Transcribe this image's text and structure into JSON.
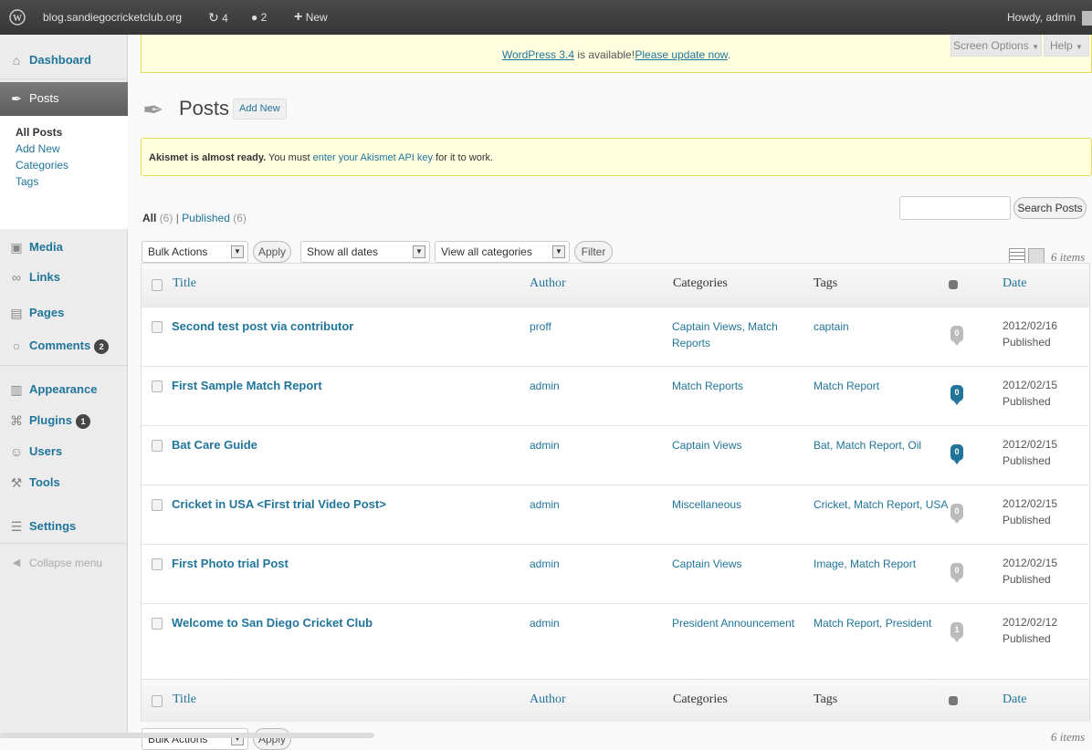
{
  "adminbar": {
    "site": "blog.sandiegocricketclub.org",
    "updates": "4",
    "comments": "2",
    "new": "New",
    "howdy": "Howdy, admin"
  },
  "menu": {
    "dashboard": "Dashboard",
    "posts": "Posts",
    "posts_sub": [
      "All Posts",
      "Add New",
      "Categories",
      "Tags"
    ],
    "media": "Media",
    "links": "Links",
    "pages": "Pages",
    "comments": "Comments",
    "comments_count": "2",
    "appearance": "Appearance",
    "plugins": "Plugins",
    "plugins_count": "1",
    "users": "Users",
    "tools": "Tools",
    "settings": "Settings",
    "collapse": "Collapse menu"
  },
  "notice": {
    "version_link": "WordPress 3.4",
    "middle": "is available!",
    "update_link": "Please update now",
    "period": "."
  },
  "screen_options": "Screen Options",
  "help": "Help",
  "page": {
    "title": "Posts",
    "add_new": "Add New"
  },
  "akismet": {
    "bold": "Akismet is almost ready.",
    "pre": "You must",
    "link": "enter your Akismet API key",
    "post": "for it to work."
  },
  "filters": {
    "all": "All",
    "all_count": "(6)",
    "sep": "|",
    "published": "Published",
    "published_count": "(6)",
    "bulk_actions": "Bulk Actions",
    "apply": "Apply",
    "dates": "Show all dates",
    "categories": "View all categories",
    "filter": "Filter",
    "items": "6 items",
    "search_button": "Search Posts",
    "search_value": ""
  },
  "table": {
    "headers": {
      "title": "Title",
      "author": "Author",
      "categories": "Categories",
      "tags": "Tags",
      "date": "Date"
    },
    "rows": [
      {
        "title": "Second test post via contributor",
        "author": "proff",
        "categories": "Captain Views, Match Reports",
        "tags": "captain",
        "comments": "0",
        "date": "2012/02/16",
        "status": "Published",
        "active": false
      },
      {
        "title": "First Sample Match Report",
        "author": "admin",
        "categories": "Match Reports",
        "tags": "Match Report",
        "comments": "0",
        "date": "2012/02/15",
        "status": "Published",
        "active": true
      },
      {
        "title": "Bat Care Guide",
        "author": "admin",
        "categories": "Captain Views",
        "tags": "Bat, Match Report, Oil",
        "comments": "0",
        "date": "2012/02/15",
        "status": "Published",
        "active": true
      },
      {
        "title": "Cricket in USA <First trial Video Post>",
        "author": "admin",
        "categories": "Miscellaneous",
        "tags": "Cricket, Match Report, USA",
        "comments": "0",
        "date": "2012/02/15",
        "status": "Published",
        "active": false
      },
      {
        "title": "First Photo trial Post",
        "author": "admin",
        "categories": "Captain Views",
        "tags": "Image, Match Report",
        "comments": "0",
        "date": "2012/02/15",
        "status": "Published",
        "active": false
      },
      {
        "title": "Welcome to San Diego Cricket Club",
        "author": "admin",
        "categories": "President Announcement",
        "tags": "Match Report, President",
        "comments": "1",
        "date": "2012/02/12",
        "status": "Published",
        "active": false
      }
    ]
  },
  "bottom": {
    "bulk_actions": "Bulk Actions",
    "apply": "Apply",
    "items": "6 items"
  }
}
